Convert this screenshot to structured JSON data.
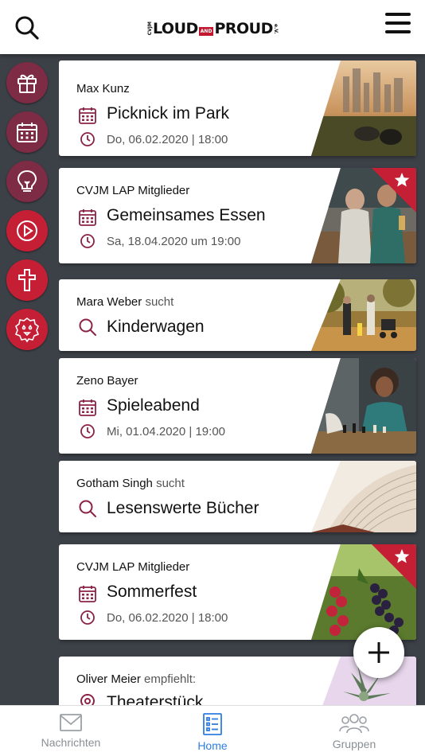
{
  "header": {
    "logo_left": "CVJM",
    "logo_loud": "LOUD",
    "logo_and": "AND",
    "logo_proud": "PROUD",
    "logo_right": "e.V."
  },
  "sidebar": {
    "items": [
      {
        "icon": "gift-icon"
      },
      {
        "icon": "calendar-icon"
      },
      {
        "icon": "lightbulb-icon"
      },
      {
        "icon": "play-icon"
      },
      {
        "icon": "cross-icon"
      },
      {
        "icon": "lion-icon"
      }
    ]
  },
  "feed": {
    "cards": [
      {
        "author": "Max Kunz",
        "action": "",
        "title": "Picknick im Park",
        "meta": "Do, 06.02.2020 | 18:00",
        "type": "event",
        "featured": false,
        "photo": "city-park-picnic"
      },
      {
        "author": "CVJM LAP Mitglieder",
        "action": "",
        "title": "Gemeinsames Essen",
        "meta": "Sa, 18.04.2020 um 19:00",
        "type": "event",
        "featured": true,
        "photo": "friends-laughing"
      },
      {
        "author": "Mara Weber",
        "action": "sucht",
        "title": "Kinderwagen",
        "meta": "",
        "type": "search",
        "featured": false,
        "photo": "family-walk"
      },
      {
        "author": "Zeno Bayer",
        "action": "",
        "title": "Spieleabend",
        "meta": "Mi, 01.04.2020 | 19:00",
        "type": "event",
        "featured": false,
        "photo": "chess-game"
      },
      {
        "author": "Gotham Singh",
        "action": "sucht",
        "title": "Lesenswerte Bücher",
        "meta": "",
        "type": "search",
        "featured": false,
        "photo": "open-book"
      },
      {
        "author": "CVJM LAP Mitglieder",
        "action": "",
        "title": "Sommerfest",
        "meta": "Do, 06.02.2020 | 18:00",
        "type": "event",
        "featured": true,
        "photo": "berries"
      },
      {
        "author": "Oliver Meier",
        "action": "empfiehlt:",
        "title": "Theaterstück",
        "meta": "",
        "type": "recommend",
        "featured": false,
        "photo": "succulent"
      }
    ]
  },
  "bottom_nav": {
    "items": [
      {
        "label": "Nachrichten",
        "icon": "mail-icon",
        "active": false
      },
      {
        "label": "Home",
        "icon": "list-icon",
        "active": true
      },
      {
        "label": "Gruppen",
        "icon": "groups-icon",
        "active": false
      }
    ]
  },
  "colors": {
    "brand_red": "#c41f35",
    "icon_maroon": "#8b2346",
    "active_blue": "#2e7de0",
    "background": "#3c4147"
  }
}
